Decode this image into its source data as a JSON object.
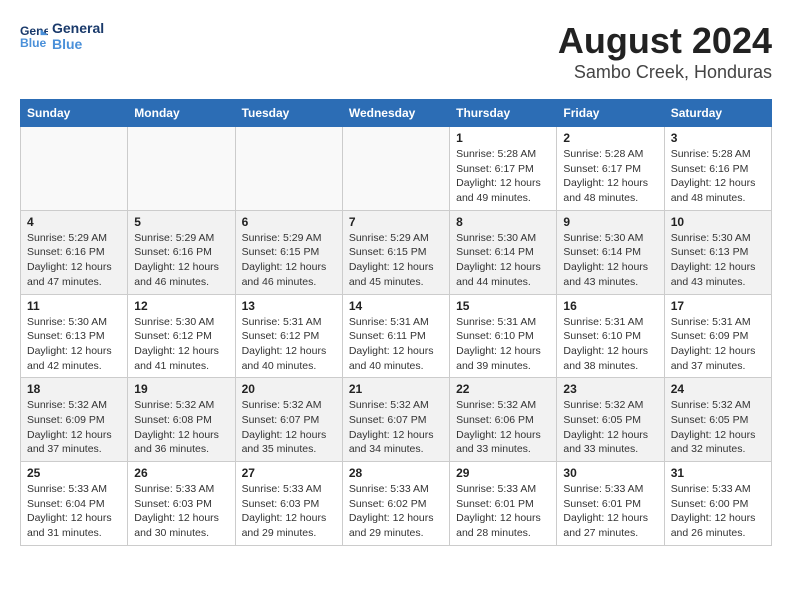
{
  "logo": {
    "line1": "General",
    "line2": "Blue"
  },
  "title": "August 2024",
  "subtitle": "Sambo Creek, Honduras",
  "days_of_week": [
    "Sunday",
    "Monday",
    "Tuesday",
    "Wednesday",
    "Thursday",
    "Friday",
    "Saturday"
  ],
  "weeks": [
    [
      {
        "day": "",
        "info": ""
      },
      {
        "day": "",
        "info": ""
      },
      {
        "day": "",
        "info": ""
      },
      {
        "day": "",
        "info": ""
      },
      {
        "day": "1",
        "info": "Sunrise: 5:28 AM\nSunset: 6:17 PM\nDaylight: 12 hours\nand 49 minutes."
      },
      {
        "day": "2",
        "info": "Sunrise: 5:28 AM\nSunset: 6:17 PM\nDaylight: 12 hours\nand 48 minutes."
      },
      {
        "day": "3",
        "info": "Sunrise: 5:28 AM\nSunset: 6:16 PM\nDaylight: 12 hours\nand 48 minutes."
      }
    ],
    [
      {
        "day": "4",
        "info": "Sunrise: 5:29 AM\nSunset: 6:16 PM\nDaylight: 12 hours\nand 47 minutes."
      },
      {
        "day": "5",
        "info": "Sunrise: 5:29 AM\nSunset: 6:16 PM\nDaylight: 12 hours\nand 46 minutes."
      },
      {
        "day": "6",
        "info": "Sunrise: 5:29 AM\nSunset: 6:15 PM\nDaylight: 12 hours\nand 46 minutes."
      },
      {
        "day": "7",
        "info": "Sunrise: 5:29 AM\nSunset: 6:15 PM\nDaylight: 12 hours\nand 45 minutes."
      },
      {
        "day": "8",
        "info": "Sunrise: 5:30 AM\nSunset: 6:14 PM\nDaylight: 12 hours\nand 44 minutes."
      },
      {
        "day": "9",
        "info": "Sunrise: 5:30 AM\nSunset: 6:14 PM\nDaylight: 12 hours\nand 43 minutes."
      },
      {
        "day": "10",
        "info": "Sunrise: 5:30 AM\nSunset: 6:13 PM\nDaylight: 12 hours\nand 43 minutes."
      }
    ],
    [
      {
        "day": "11",
        "info": "Sunrise: 5:30 AM\nSunset: 6:13 PM\nDaylight: 12 hours\nand 42 minutes."
      },
      {
        "day": "12",
        "info": "Sunrise: 5:30 AM\nSunset: 6:12 PM\nDaylight: 12 hours\nand 41 minutes."
      },
      {
        "day": "13",
        "info": "Sunrise: 5:31 AM\nSunset: 6:12 PM\nDaylight: 12 hours\nand 40 minutes."
      },
      {
        "day": "14",
        "info": "Sunrise: 5:31 AM\nSunset: 6:11 PM\nDaylight: 12 hours\nand 40 minutes."
      },
      {
        "day": "15",
        "info": "Sunrise: 5:31 AM\nSunset: 6:10 PM\nDaylight: 12 hours\nand 39 minutes."
      },
      {
        "day": "16",
        "info": "Sunrise: 5:31 AM\nSunset: 6:10 PM\nDaylight: 12 hours\nand 38 minutes."
      },
      {
        "day": "17",
        "info": "Sunrise: 5:31 AM\nSunset: 6:09 PM\nDaylight: 12 hours\nand 37 minutes."
      }
    ],
    [
      {
        "day": "18",
        "info": "Sunrise: 5:32 AM\nSunset: 6:09 PM\nDaylight: 12 hours\nand 37 minutes."
      },
      {
        "day": "19",
        "info": "Sunrise: 5:32 AM\nSunset: 6:08 PM\nDaylight: 12 hours\nand 36 minutes."
      },
      {
        "day": "20",
        "info": "Sunrise: 5:32 AM\nSunset: 6:07 PM\nDaylight: 12 hours\nand 35 minutes."
      },
      {
        "day": "21",
        "info": "Sunrise: 5:32 AM\nSunset: 6:07 PM\nDaylight: 12 hours\nand 34 minutes."
      },
      {
        "day": "22",
        "info": "Sunrise: 5:32 AM\nSunset: 6:06 PM\nDaylight: 12 hours\nand 33 minutes."
      },
      {
        "day": "23",
        "info": "Sunrise: 5:32 AM\nSunset: 6:05 PM\nDaylight: 12 hours\nand 33 minutes."
      },
      {
        "day": "24",
        "info": "Sunrise: 5:32 AM\nSunset: 6:05 PM\nDaylight: 12 hours\nand 32 minutes."
      }
    ],
    [
      {
        "day": "25",
        "info": "Sunrise: 5:33 AM\nSunset: 6:04 PM\nDaylight: 12 hours\nand 31 minutes."
      },
      {
        "day": "26",
        "info": "Sunrise: 5:33 AM\nSunset: 6:03 PM\nDaylight: 12 hours\nand 30 minutes."
      },
      {
        "day": "27",
        "info": "Sunrise: 5:33 AM\nSunset: 6:03 PM\nDaylight: 12 hours\nand 29 minutes."
      },
      {
        "day": "28",
        "info": "Sunrise: 5:33 AM\nSunset: 6:02 PM\nDaylight: 12 hours\nand 29 minutes."
      },
      {
        "day": "29",
        "info": "Sunrise: 5:33 AM\nSunset: 6:01 PM\nDaylight: 12 hours\nand 28 minutes."
      },
      {
        "day": "30",
        "info": "Sunrise: 5:33 AM\nSunset: 6:01 PM\nDaylight: 12 hours\nand 27 minutes."
      },
      {
        "day": "31",
        "info": "Sunrise: 5:33 AM\nSunset: 6:00 PM\nDaylight: 12 hours\nand 26 minutes."
      }
    ]
  ]
}
